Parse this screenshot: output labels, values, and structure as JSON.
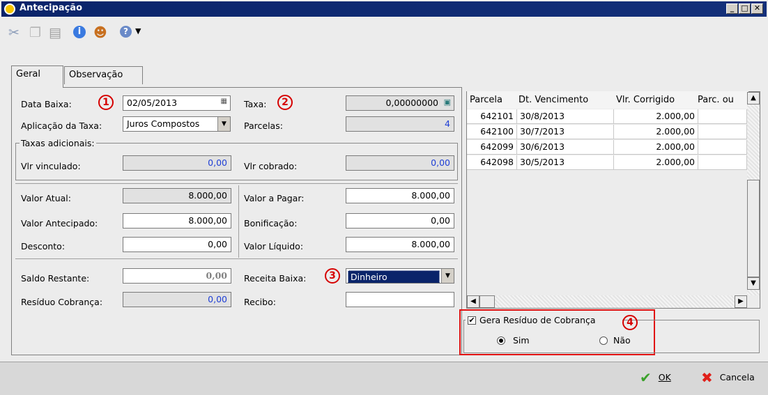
{
  "window": {
    "title": "Antecipação"
  },
  "tabs": [
    {
      "label": "Geral"
    },
    {
      "label": "Observação"
    }
  ],
  "form": {
    "data_baixa_label": "Data Baixa:",
    "data_baixa_value": "02/05/2013",
    "taxa_label": "Taxa:",
    "taxa_value": "0,00000000",
    "aplicacao_label": "Aplicação da Taxa:",
    "aplicacao_value": "Juros Compostos",
    "parcelas_label": "Parcelas:",
    "parcelas_value": "4",
    "taxas_adicionais_label": "Taxas adicionais:",
    "vlr_vinculado_label": "Vlr vinculado:",
    "vlr_vinculado_value": "0,00",
    "vlr_cobrado_label": "Vlr cobrado:",
    "vlr_cobrado_value": "0,00",
    "valor_atual_label": "Valor Atual:",
    "valor_atual_value": "8.000,00",
    "valor_pagar_label": "Valor a Pagar:",
    "valor_pagar_value": "8.000,00",
    "valor_antecipado_label": "Valor Antecipado:",
    "valor_antecipado_value": "8.000,00",
    "bonificacao_label": "Bonificação:",
    "bonificacao_value": "0,00",
    "desconto_label": "Desconto:",
    "desconto_value": "0,00",
    "valor_liquido_label": "Valor Líquido:",
    "valor_liquido_value": "8.000,00",
    "saldo_restante_label": "Saldo Restante:",
    "saldo_restante_value": "0,00",
    "receita_baixa_label": "Receita Baixa:",
    "receita_baixa_value": "Dinheiro",
    "residuo_cobranca_label": "Resíduo Cobrança:",
    "residuo_cobranca_value": "0,00",
    "recibo_label": "Recibo:",
    "recibo_value": ""
  },
  "callouts": [
    "1",
    "2",
    "3",
    "4"
  ],
  "grid": {
    "columns": [
      "Parcela",
      "Dt. Vencimento",
      "Vlr. Corrigido",
      "Parc. ou"
    ],
    "rows": [
      {
        "parcela": "642101",
        "vencimento": "30/8/2013",
        "valor": "2.000,00"
      },
      {
        "parcela": "642100",
        "vencimento": "30/7/2013",
        "valor": "2.000,00"
      },
      {
        "parcela": "642099",
        "vencimento": "30/6/2013",
        "valor": "2.000,00"
      },
      {
        "parcela": "642098",
        "vencimento": "30/5/2013",
        "valor": "2.000,00"
      }
    ]
  },
  "residuo": {
    "checkbox_label": "Gera Resíduo de Cobrança",
    "checked": true,
    "sim_label": "Sim",
    "nao_label": "Não",
    "selected": "Sim"
  },
  "buttons": {
    "ok": "OK",
    "cancel": "Cancela"
  },
  "colors": {
    "accent": "#d60000",
    "title_bar": "#0a246a",
    "selection": "#0a246a",
    "value_blue": "#1f3fd6"
  },
  "icons": [
    "scissors-icon",
    "copy-icon",
    "paste-icon",
    "info-icon",
    "user-icon",
    "help-icon",
    "check-icon",
    "x-icon"
  ]
}
